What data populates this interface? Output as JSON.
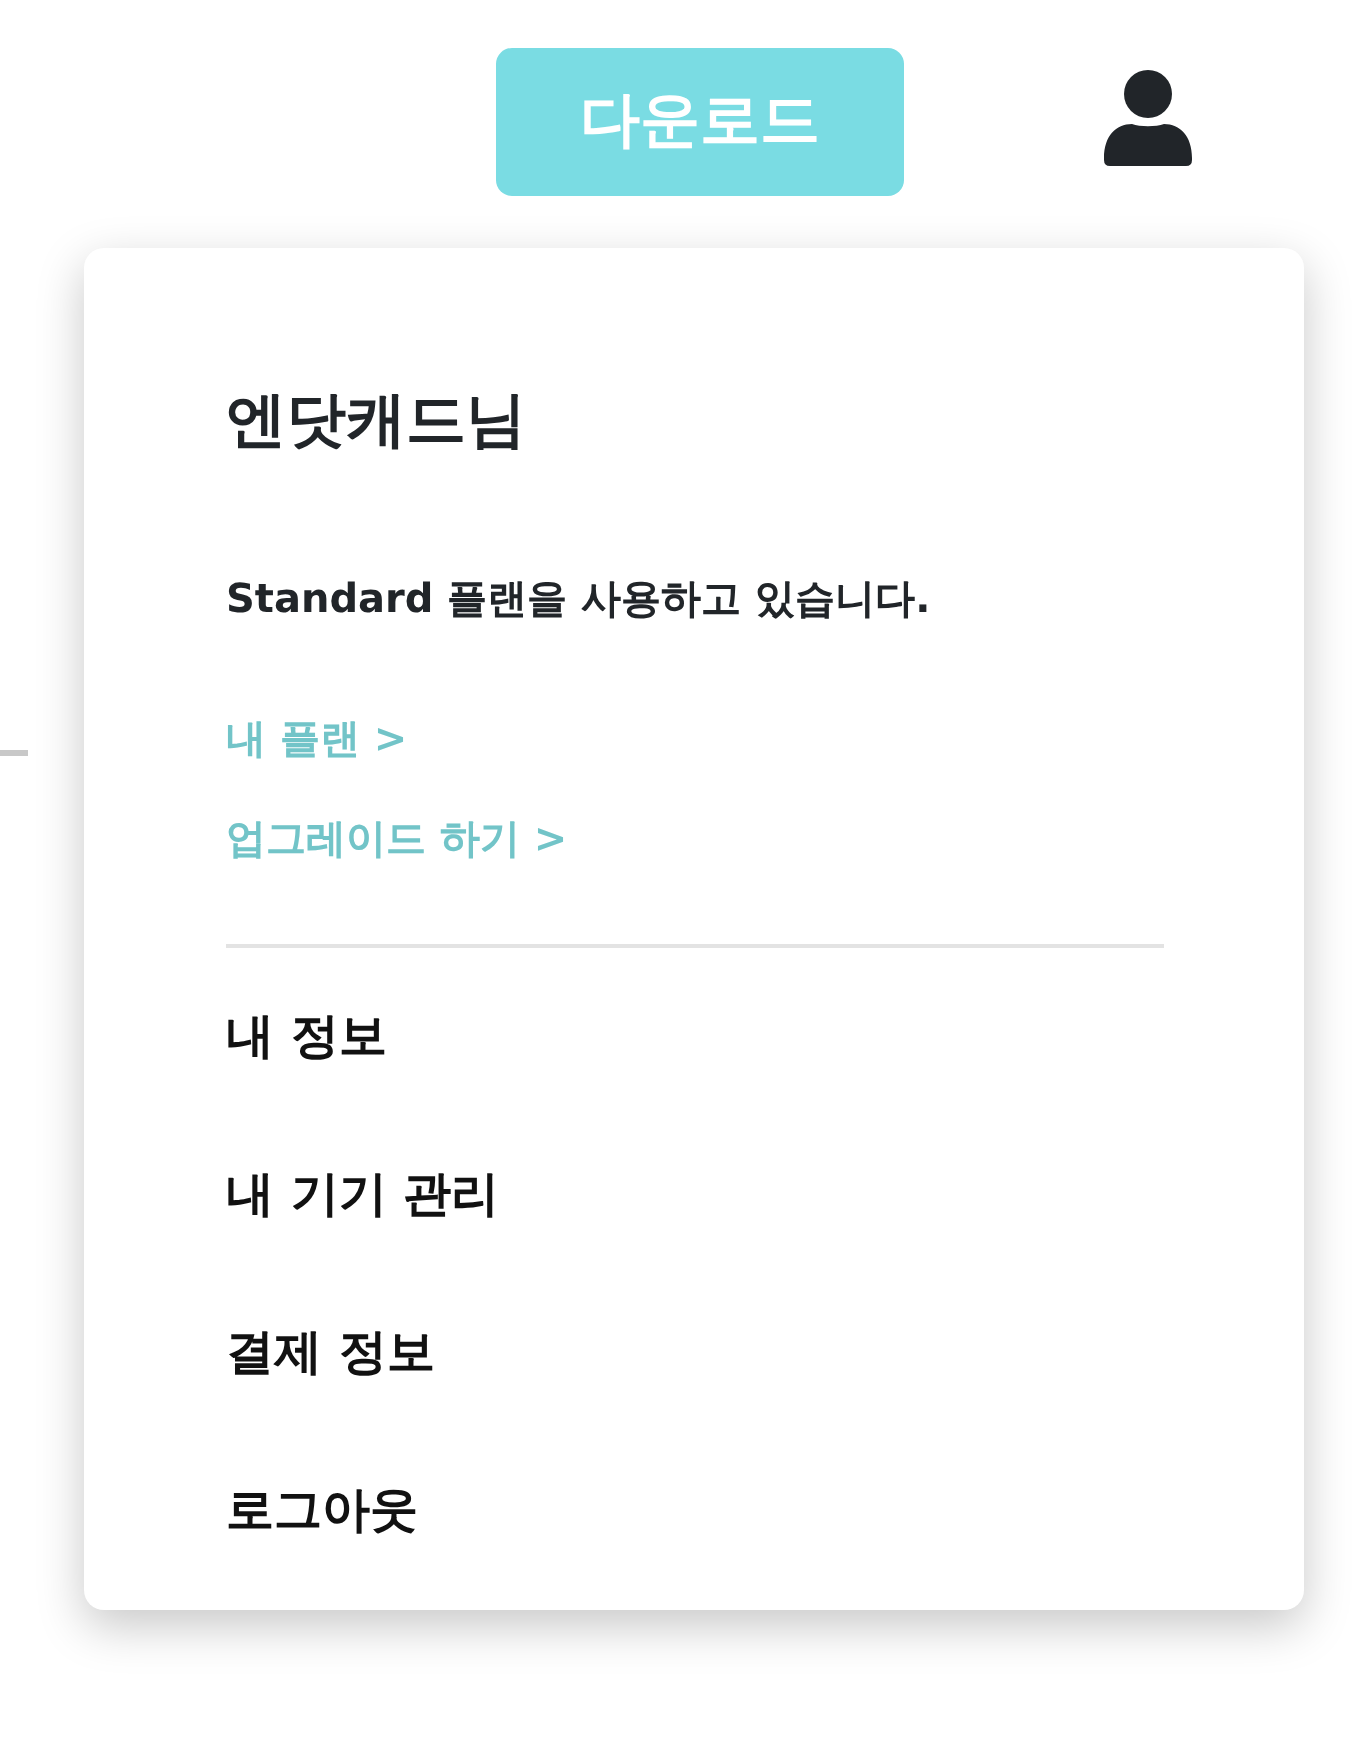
{
  "header": {
    "download_button": "다운로드"
  },
  "account_menu": {
    "greeting": "엔닷캐드님",
    "plan_text": "Standard 플랜을 사용하고 있습니다.",
    "links": [
      "내 플랜 >",
      "업그레이드 하기 >"
    ],
    "items": [
      "내 정보",
      "내 기기 관리",
      "결제 정보",
      "로그아웃"
    ]
  }
}
